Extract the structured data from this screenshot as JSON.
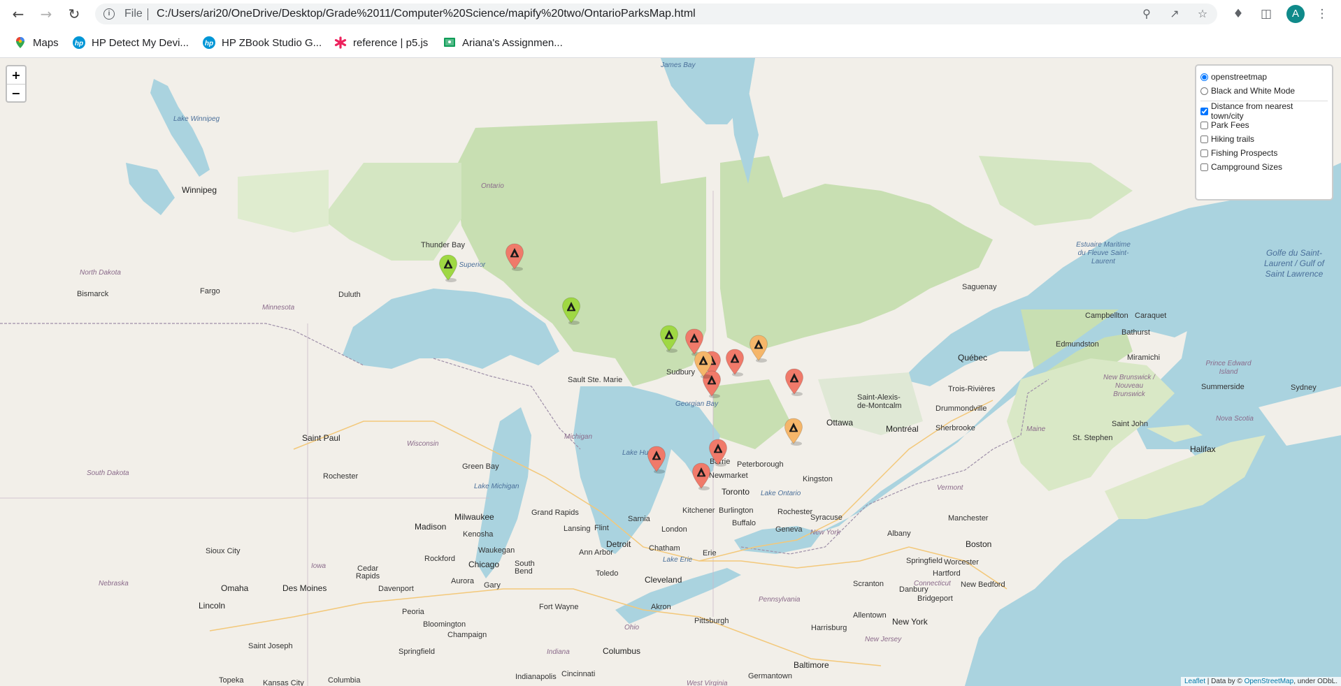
{
  "browser": {
    "file_label": "File",
    "url": "C:/Users/ari20/OneDrive/Desktop/Grade%2011/Computer%20Science/mapify%20two/OntarioParksMap.html",
    "avatar_letter": "A",
    "avatar_color": "#0f8a8a"
  },
  "bookmarks": [
    {
      "label": "Maps",
      "icon": "maps-pin-icon"
    },
    {
      "label": "HP Detect My Devi...",
      "icon": "hp-logo-icon"
    },
    {
      "label": "HP ZBook Studio G...",
      "icon": "hp-logo-icon"
    },
    {
      "label": "reference | p5.js",
      "icon": "p5-star-icon"
    },
    {
      "label": "Ariana's Assignmen...",
      "icon": "classroom-icon"
    }
  ],
  "map": {
    "zoom_in": "+",
    "zoom_out": "−",
    "base_layers": [
      {
        "label": "openstreetmap",
        "checked": true
      },
      {
        "label": "Black and White Mode",
        "checked": false
      }
    ],
    "overlays": [
      {
        "label": "Distance from nearest town/city",
        "checked": true
      },
      {
        "label": "Park Fees",
        "checked": false
      },
      {
        "label": "Hiking trails",
        "checked": false
      },
      {
        "label": "Fishing Prospects",
        "checked": false
      },
      {
        "label": "Campground Sizes",
        "checked": false
      }
    ],
    "attribution": {
      "leaflet": "Leaflet",
      "mid": " | Data by © ",
      "osm": "OpenStreetMap",
      "tail": ", under ODbL."
    },
    "marker_colors": {
      "green": "#9fd843",
      "red": "#f07a6a",
      "orange": "#f5b66a"
    },
    "places": {
      "james_bay": "James Bay",
      "lake_winnipeg": "Lake Winnipeg",
      "winnipeg": "Winnipeg",
      "ontario": "Ontario",
      "thunder_bay": "Thunder Bay",
      "lake_superior": "Lake Superior",
      "north_dakota": "North Dakota",
      "bismarck": "Bismarck",
      "fargo": "Fargo",
      "duluth": "Duluth",
      "minnesota": "Minnesota",
      "saint_paul": "Saint Paul",
      "wisconsin": "Wisconsin",
      "south_dakota": "South Dakota",
      "rochester_mn": "Rochester",
      "green_bay": "Green Bay",
      "michigan": "Michigan",
      "lake_michigan": "Lake Michigan",
      "milwaukee": "Milwaukee",
      "madison": "Madison",
      "grand_rapids": "Grand Rapids",
      "lansing": "Lansing",
      "flint": "Flint",
      "detroit": "Detroit",
      "ann_arbor": "Ann Arbor",
      "sault_ste_marie": "Sault Ste. Marie",
      "sudbury": "Sudbury",
      "georgian_bay": "Georgian Bay",
      "lake_huron": "Lake Huron",
      "barrie": "Barrie",
      "newmarket": "Newmarket",
      "peterborough": "Peterborough",
      "toronto": "Toronto",
      "kingston": "Kingston",
      "lake_ontario": "Lake Ontario",
      "kitchener": "Kitchener",
      "burlington": "Burlington",
      "sarnia": "Sarnia",
      "london": "London",
      "chatham": "Chatham",
      "buffalo": "Buffalo",
      "rochester": "Rochester",
      "syracuse": "Syracuse",
      "geneva": "Geneva",
      "erie": "Erie",
      "lake_erie": "Lake Erie",
      "cleveland": "Cleveland",
      "toledo": "Toledo",
      "ottawa": "Ottawa",
      "montreal": "Montréal",
      "quebec": "Québec",
      "saguenay": "Saguenay",
      "trois_rivieres": "Trois-Rivières",
      "drummondville": "Drummondville",
      "sherbrooke": "Sherbrooke",
      "saint_alexis": "Saint-Alexis-de-Montcalm",
      "estuaire": "Estuaire Maritime du Fleuve Saint-Laurent",
      "golfe": "Golfe du Saint-Laurent / Gulf of Saint Lawrence",
      "campbellton": "Campbellton",
      "caraquet": "Caraquet",
      "bathurst": "Bathurst",
      "edmundston": "Edmundston",
      "miramichi": "Miramichi",
      "new_brunswick": "New Brunswick / Nouveau Brunswick",
      "pei": "Prince Edward Island",
      "summerside": "Summerside",
      "sydney": "Sydney",
      "saint_john": "Saint John",
      "st_stephen": "St. Stephen",
      "nova_scotia": "Nova Scotia",
      "halifax": "Halifax",
      "maine": "Maine",
      "vermont": "Vermont",
      "new_york_state": "New York",
      "albany": "Albany",
      "manchester": "Manchester",
      "boston": "Boston",
      "springfield": "Springfield",
      "worcester": "Worcester",
      "hartford": "Hartford",
      "new_bedford": "New Bedford",
      "danbury": "Danbury",
      "bridgeport": "Bridgeport",
      "connecticut": "Connecticut",
      "new_york": "New York",
      "allentown": "Allentown",
      "scranton": "Scranton",
      "new_jersey": "New Jersey",
      "harrisburg": "Harrisburg",
      "pennsylvania": "Pennsylvania",
      "baltimore": "Baltimore",
      "germantown": "Germantown",
      "pittsburgh": "Pittsburgh",
      "akron": "Akron",
      "ohio": "Ohio",
      "columbus": "Columbus",
      "cincinnati": "Cincinnati",
      "indiana": "Indiana",
      "fort_wayne": "Fort Wayne",
      "chicago": "Chicago",
      "aurora": "Aurora",
      "gary": "Gary",
      "south_bend": "South Bend",
      "kenosha": "Kenosha",
      "waukegan": "Waukegan",
      "rockford": "Rockford",
      "davenport": "Davenport",
      "cedar_rapids": "Cedar Rapids",
      "iowa": "Iowa",
      "des_moines": "Des Moines",
      "omaha": "Omaha",
      "lincoln": "Lincoln",
      "nebraska": "Nebraska",
      "sioux_city": "Sioux City",
      "peoria": "Peoria",
      "bloomington": "Bloomington",
      "champaign": "Champaign",
      "springfield_il": "Springfield",
      "saint_joseph": "Saint Joseph",
      "topeka": "Topeka",
      "kansas_city": "Kansas City",
      "columbia": "Columbia",
      "west_virginia": "West Virginia",
      "indianapolis": "Indianapolis"
    }
  }
}
